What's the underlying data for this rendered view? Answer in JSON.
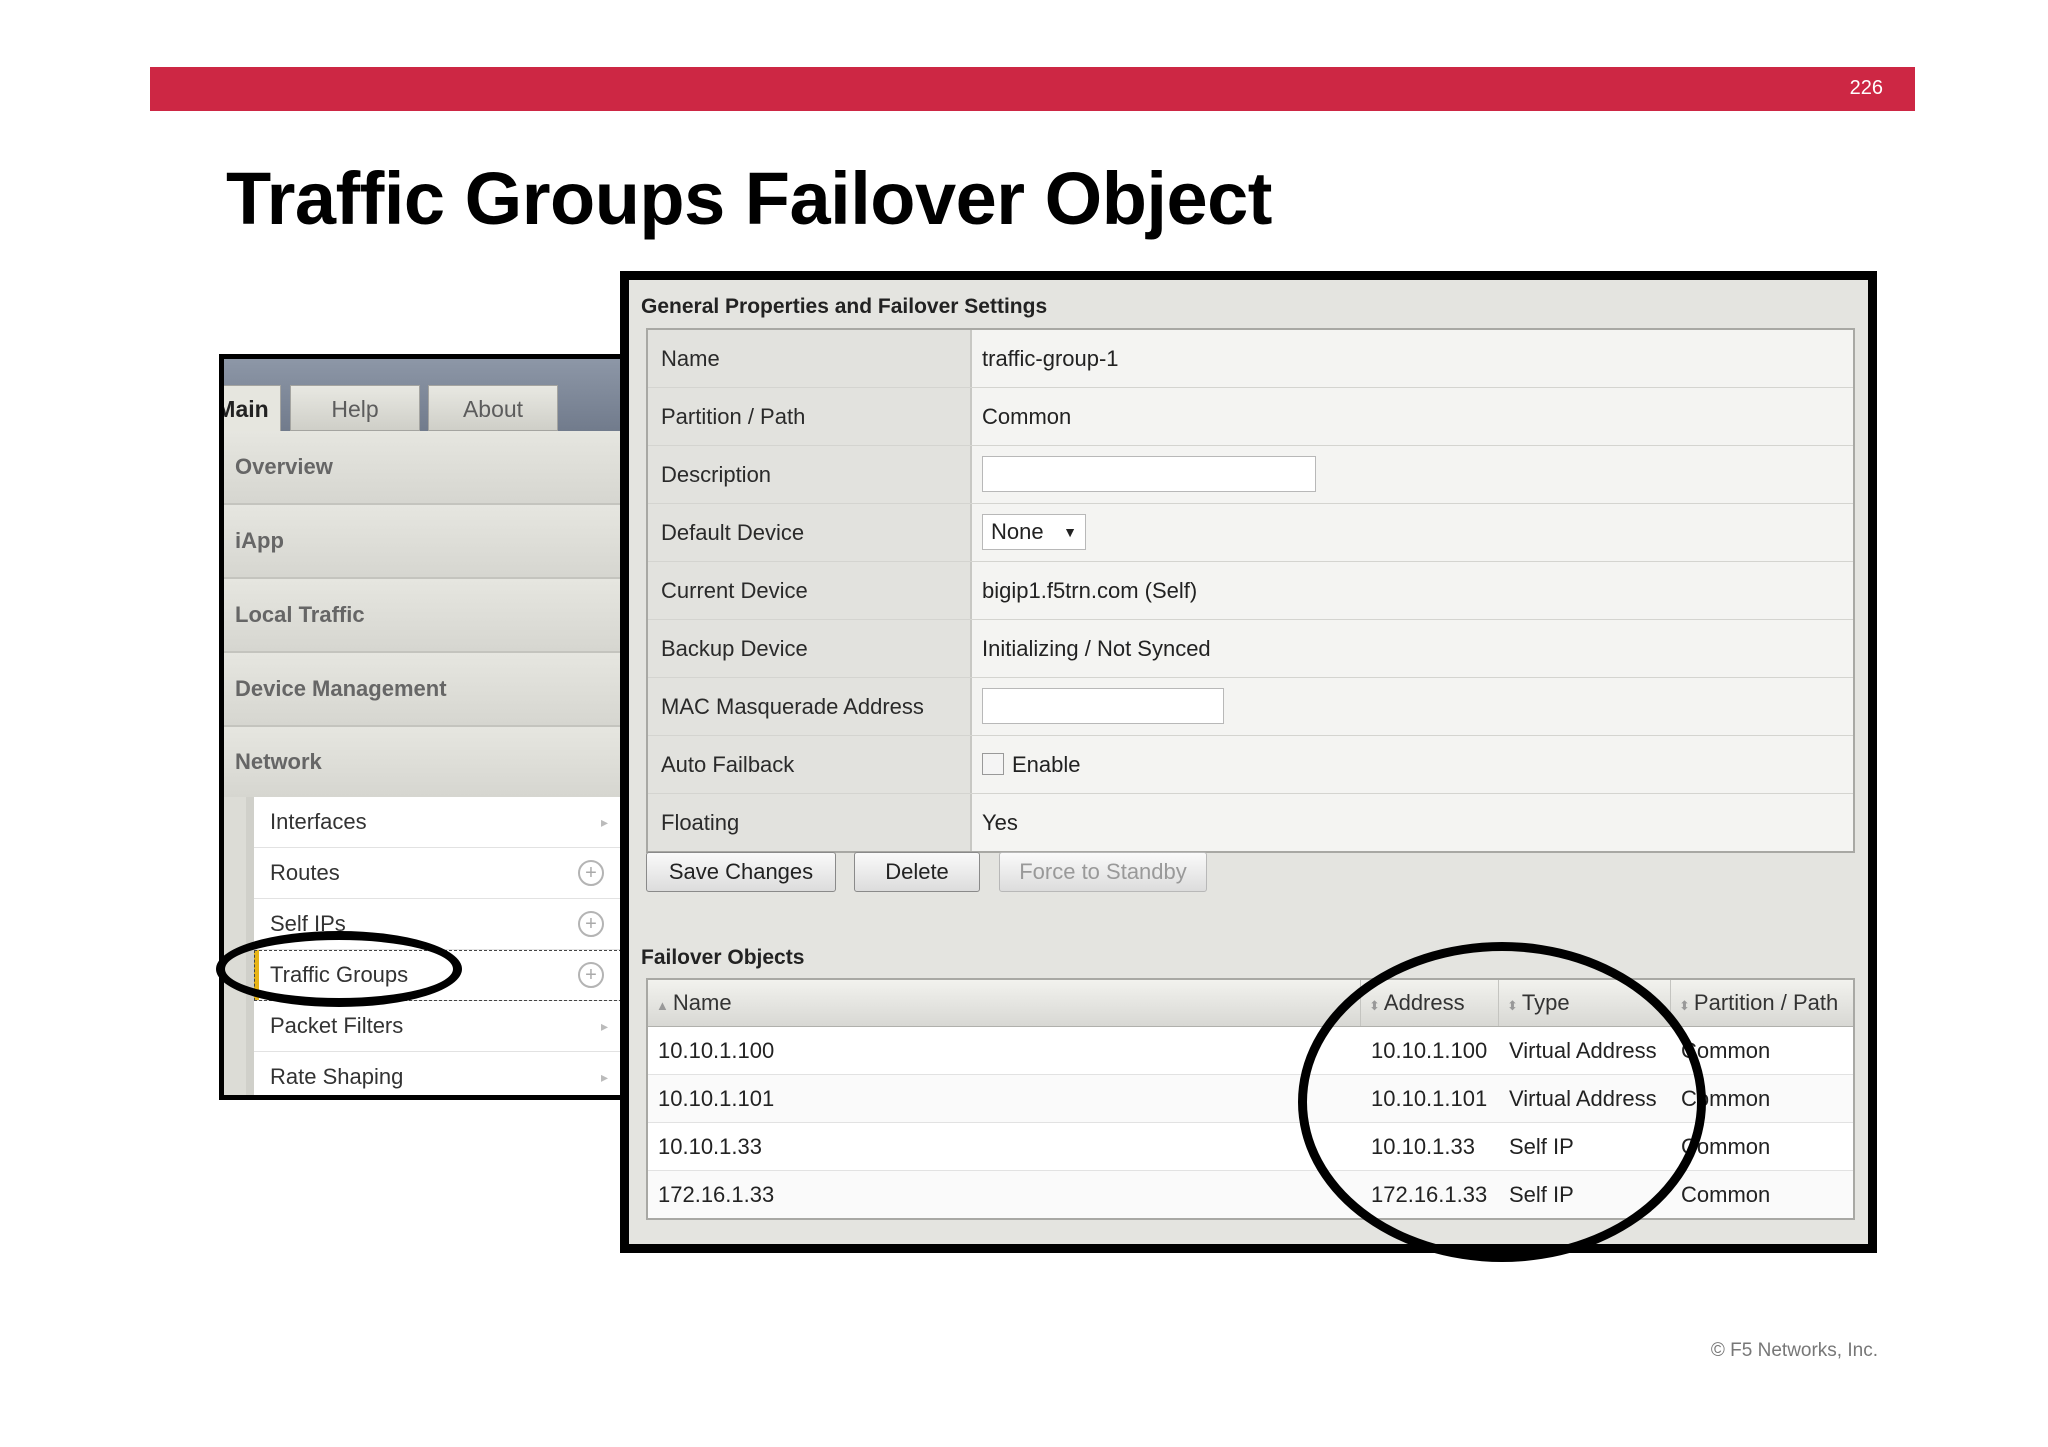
{
  "slide": {
    "page_number": "226",
    "title": "Traffic Groups Failover Object",
    "copyright": "© F5 Networks, Inc.",
    "accent_color": "#cd2744"
  },
  "nav": {
    "tabs": [
      "Main",
      "Help",
      "About"
    ],
    "sections": [
      "Overview",
      "iApp",
      "Local Traffic",
      "Device Management",
      "Network"
    ],
    "sub_items": [
      {
        "label": "Interfaces",
        "icon": "arrow-right-icon"
      },
      {
        "label": "Routes",
        "icon": "plus-circle-icon"
      },
      {
        "label": "Self IPs",
        "icon": "plus-circle-icon"
      },
      {
        "label": "Traffic Groups",
        "icon": "plus-circle-icon",
        "selected": true
      },
      {
        "label": "Packet Filters",
        "icon": "arrow-right-icon"
      },
      {
        "label": "Rate Shaping",
        "icon": "arrow-right-icon"
      }
    ]
  },
  "general": {
    "section_title": "General Properties and Failover Settings",
    "name_label": "Name",
    "name_value": "traffic-group-1",
    "partition_label": "Partition / Path",
    "partition_value": "Common",
    "description_label": "Description",
    "description_value": "",
    "default_device_label": "Default Device",
    "default_device_value": "None",
    "current_device_label": "Current Device",
    "current_device_value": "bigip1.f5trn.com (Self)",
    "backup_device_label": "Backup Device",
    "backup_device_value": "Initializing / Not Synced",
    "mac_label": "MAC Masquerade Address",
    "mac_value": "",
    "auto_failback_label": "Auto Failback",
    "auto_failback_checkbox": "Enable",
    "floating_label": "Floating",
    "floating_value": "Yes"
  },
  "buttons": {
    "save": "Save Changes",
    "delete": "Delete",
    "force_standby": "Force to Standby"
  },
  "failover": {
    "section_title": "Failover Objects",
    "columns": [
      "Name",
      "Address",
      "Type",
      "Partition / Path"
    ],
    "rows": [
      [
        "10.10.1.100",
        "10.10.1.100",
        "Virtual Address",
        "Common"
      ],
      [
        "10.10.1.101",
        "10.10.1.101",
        "Virtual Address",
        "Common"
      ],
      [
        "10.10.1.33",
        "10.10.1.33",
        "Self IP",
        "Common"
      ],
      [
        "172.16.1.33",
        "172.16.1.33",
        "Self IP",
        "Common"
      ]
    ]
  }
}
